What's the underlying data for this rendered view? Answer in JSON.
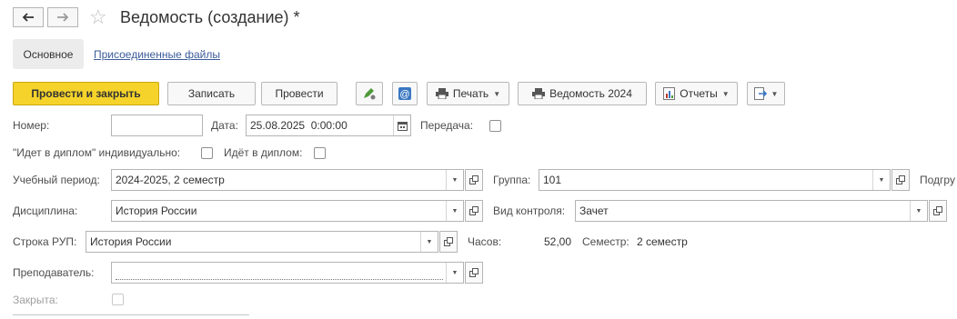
{
  "window": {
    "title": "Ведомость (создание) *"
  },
  "tabs": {
    "main": "Основное",
    "files": "Присоединенные файлы"
  },
  "toolbar": {
    "post_close": "Провести и закрыть",
    "save": "Записать",
    "post": "Провести",
    "print": "Печать",
    "vedomost": "Ведомость 2024",
    "reports": "Отчеты"
  },
  "form": {
    "number": {
      "label": "Номер:",
      "value": ""
    },
    "date": {
      "label": "Дата:",
      "value": "25.08.2025  0:00:00"
    },
    "transfer": {
      "label": "Передача:"
    },
    "diploma_individual": {
      "label": "\"Идет в диплом\" индивидуально:"
    },
    "diploma": {
      "label": "Идёт в диплом:"
    },
    "period": {
      "label": "Учебный период:",
      "value": "2024-2025, 2 семестр"
    },
    "group": {
      "label": "Группа:",
      "value": "101"
    },
    "subgroup": {
      "label": "Подгру"
    },
    "discipline": {
      "label": "Дисциплина:",
      "value": "История России"
    },
    "control_type": {
      "label": "Вид контроля:",
      "value": "Зачет"
    },
    "rup": {
      "label": "Строка РУП:",
      "value": "История России"
    },
    "hours": {
      "label": "Часов:",
      "value": "52,00"
    },
    "semester": {
      "label": "Семестр:",
      "value": "2 семестр"
    },
    "teacher": {
      "label": "Преподаватель:",
      "value": ""
    },
    "closed": {
      "label": "Закрыта:"
    }
  }
}
